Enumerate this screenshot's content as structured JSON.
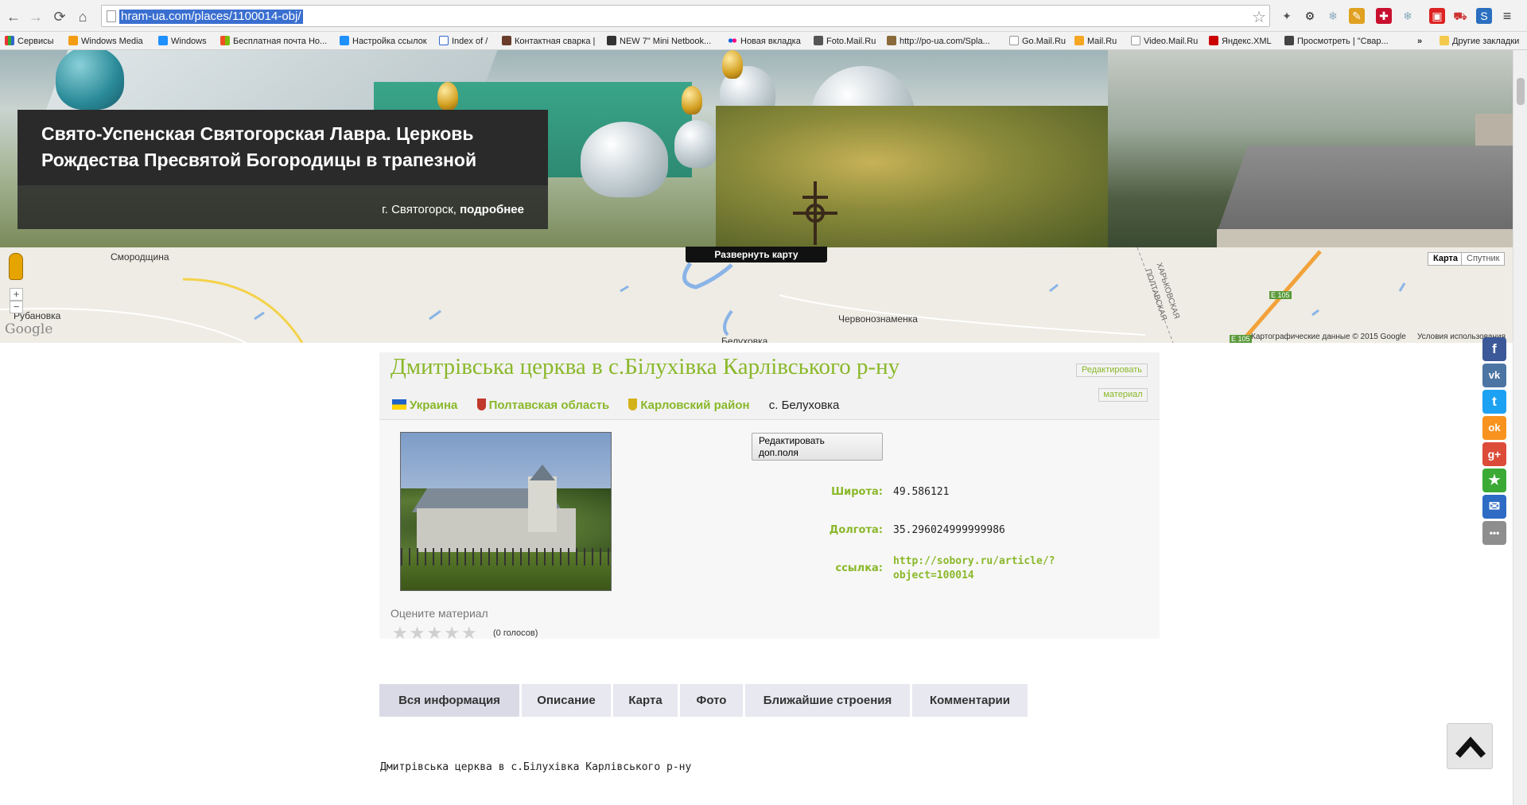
{
  "browser": {
    "url": "hram-ua.com/places/1100014-obj/",
    "bookmarks": [
      {
        "label": "Сервисы",
        "icon": "apps-icon"
      },
      {
        "label": "Windows Media",
        "icon": "windows-media-icon"
      },
      {
        "label": "Windows",
        "icon": "windows-icon"
      },
      {
        "label": "Бесплатная почта Ho...",
        "icon": "windows-icon"
      },
      {
        "label": "Настройка ссылок",
        "icon": "windows-icon"
      },
      {
        "label": "Index of /",
        "icon": "index-icon"
      },
      {
        "label": "Контактная сварка |",
        "icon": "site-icon"
      },
      {
        "label": "NEW 7\" Mini Netbook...",
        "icon": "site-icon"
      },
      {
        "label": "Новая вкладка",
        "icon": "flickr-icon"
      },
      {
        "label": "Foto.Mail.Ru",
        "icon": "camera-icon"
      },
      {
        "label": "http://po-ua.com/Spla...",
        "icon": "site-icon"
      },
      {
        "label": "Go.Mail.Ru",
        "icon": "page-icon"
      },
      {
        "label": "Mail.Ru",
        "icon": "mail-icon"
      },
      {
        "label": "Video.Mail.Ru",
        "icon": "page-icon"
      },
      {
        "label": "Яндекс.XML",
        "icon": "yandex-icon"
      },
      {
        "label": "Просмотреть | \"Свар...",
        "icon": "site-icon"
      }
    ],
    "more_bookmarks": "»",
    "other_bookmarks": "Другие закладки"
  },
  "hero": {
    "title": "Свято-Успенская Святогорская Лавра. Церковь Рождества Пресвятой Богородицы в трапезной",
    "place": "г. Святогорск,",
    "more": "подробнее"
  },
  "map": {
    "expand_label": "Развернуть карту",
    "type_map": "Карта",
    "type_satellite": "Спутник",
    "zoom_in": "+",
    "zoom_out": "−",
    "labels": [
      "Смородщина",
      "Рубановка",
      "Червонознаменка",
      "Белуховка",
      "ХАРЬКОВСКАЯ",
      "ПОЛТАВСКАЯ",
      "E 105",
      "E 105"
    ],
    "copyright": "Картографические данные © 2015 Google",
    "terms": "Условия использования",
    "logo": "Google"
  },
  "object": {
    "title": "Дмитрівська церква в с.Білухівка Карлівського р-ну",
    "edit_label_1": "Редактировать",
    "edit_label_2": "материал",
    "breadcrumbs": [
      {
        "label": "Украина"
      },
      {
        "label": "Полтавская область"
      },
      {
        "label": "Карловский район"
      },
      {
        "label": "с. Белуховка"
      }
    ],
    "edit_extra_1": "Редактировать",
    "edit_extra_2": "доп.поля",
    "lat_label": "Широта:",
    "lat_value": "49.586121",
    "lon_label": "Долгота:",
    "lon_value": "35.296024999999986",
    "link_label": "ссылка:",
    "link_value_1": "http://sobory.ru/article/?",
    "link_value_2": "object=100014",
    "rate_label": "Оцените материал",
    "rating_stars": 5,
    "rating_value": 0,
    "votes": "(0 голосов)"
  },
  "tabs": [
    {
      "label": "Вся информация"
    },
    {
      "label": "Описание"
    },
    {
      "label": "Карта"
    },
    {
      "label": "Фото"
    },
    {
      "label": "Ближайшие строения"
    },
    {
      "label": "Комментарии"
    }
  ],
  "description": "Дмитрівська церква в с.Білухівка Карлівського р-ну",
  "share": [
    {
      "name": "facebook",
      "glyph": "f",
      "color": "#3b5998"
    },
    {
      "name": "vk",
      "glyph": "vk",
      "color": "#4c75a3"
    },
    {
      "name": "twitter",
      "glyph": "t",
      "color": "#1da1f2"
    },
    {
      "name": "odnoklassniki",
      "glyph": "ok",
      "color": "#f7931e"
    },
    {
      "name": "google-plus",
      "glyph": "g+",
      "color": "#dd4b39"
    },
    {
      "name": "favorite",
      "glyph": "★",
      "color": "#3aaa35"
    },
    {
      "name": "email",
      "glyph": "✉",
      "color": "#2d6bc4"
    },
    {
      "name": "more",
      "glyph": "•••",
      "color": "#8e8e8e"
    }
  ],
  "accent_color": "#8ab82a"
}
